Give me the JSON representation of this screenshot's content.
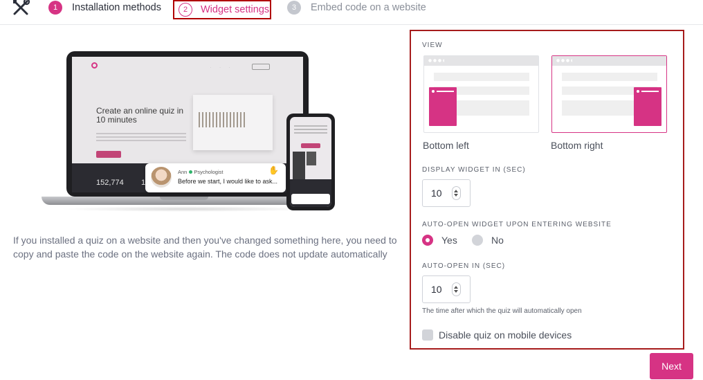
{
  "steps": {
    "icon": "tools-icon",
    "items": [
      {
        "number": "1",
        "label": "Installation methods",
        "state": "completed"
      },
      {
        "number": "2",
        "label": "Widget settings",
        "state": "active"
      },
      {
        "number": "3",
        "label": "Embed code on a website",
        "state": "upcoming"
      }
    ]
  },
  "preview": {
    "laptop": {
      "headline": "Create an online quiz in 10 minutes",
      "stat_1": "152,774",
      "stat_2": "10+"
    },
    "chat": {
      "name": "Ann",
      "role": "Psychologist",
      "message": "Before we start, I would like to ask..."
    }
  },
  "info_text": "If you installed a quiz on a website and then you've changed something here, you need to copy and paste the code on the website again. The code does not update automatically",
  "settings": {
    "view": {
      "label": "VIEW",
      "options": [
        {
          "label": "Bottom left",
          "selected": false
        },
        {
          "label": "Bottom right",
          "selected": true
        }
      ]
    },
    "display_widget": {
      "label": "DISPLAY WIDGET IN (SEC)",
      "value": "10"
    },
    "auto_open": {
      "label": "AUTO-OPEN WIDGET UPON ENTERING WEBSITE",
      "options": [
        {
          "label": "Yes",
          "selected": true
        },
        {
          "label": "No",
          "selected": false
        }
      ]
    },
    "auto_open_in": {
      "label": "AUTO-OPEN IN (SEC)",
      "value": "10",
      "hint": "The time after which the quiz will automatically open"
    },
    "disable_mobile": {
      "label": "Disable quiz on mobile devices",
      "checked": false
    }
  },
  "footer": {
    "next_label": "Next"
  },
  "colors": {
    "accent": "#d63384",
    "highlight_border": "#a61b1b"
  }
}
